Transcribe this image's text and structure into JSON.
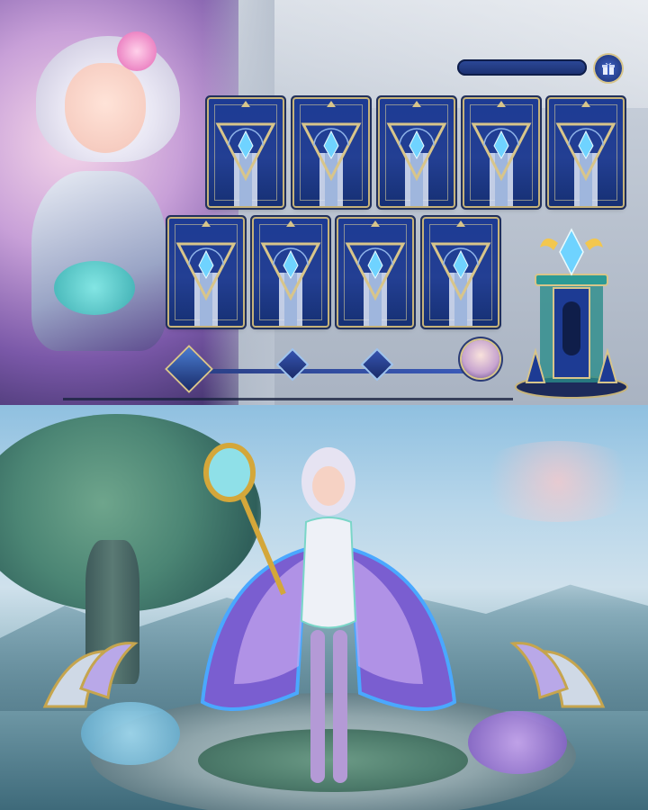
{
  "event": {
    "card_slots_row1": 5,
    "card_slots_row2": 4,
    "milestones": [
      "start-token",
      "milestone-1",
      "milestone-2",
      "milestone-3",
      "final-reward"
    ],
    "progress_fraction": 0.0
  },
  "icons": {
    "gift": "gift-icon",
    "card_back": "crystal-card-back",
    "milestone": "mask-milestone-icon",
    "final": "hero-portrait-reward",
    "pedestal": "crystal-pedestal-reward"
  },
  "colors": {
    "card_blue": "#1d3b94",
    "gold_trim": "#c6b37a",
    "crystal": "#6fd3ff",
    "track_blue": "#2a3f86"
  }
}
